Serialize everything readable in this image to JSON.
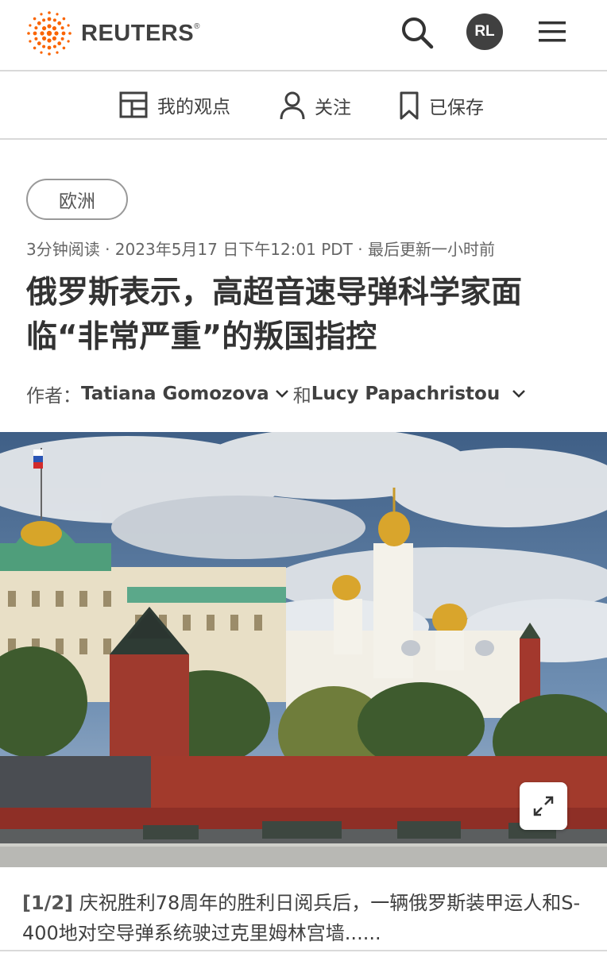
{
  "header": {
    "brand": "REUTERS",
    "brand_mark": "®",
    "avatar_initials": "RL",
    "icons": [
      "reuters-logo-icon",
      "search-icon",
      "hamburger-menu-icon"
    ]
  },
  "subnav": {
    "my_view": "我的观点",
    "following": "关注",
    "saved": "已保存"
  },
  "article": {
    "section": "欧洲",
    "meta": "3分钟阅读 · 2023年5月17 日下午12:01 PDT · 最后更新一小时前",
    "headline": "俄罗斯表示，高超音速导弹科学家面临“非常严重”的叛国指控",
    "byline_prefix": "作者：",
    "author1": "Tatiana Gomozova",
    "conjunction": "和",
    "author2": "Lucy Papachristou"
  },
  "photo": {
    "index": "[1/2]",
    "caption": "庆祝胜利78周年的胜利日阅兵后，一辆俄罗斯装甲运人和S-400地对空导弹系统驶过克里姆林宫墙......"
  },
  "colors": {
    "brand_orange": "#fa6400",
    "text_dark": "#404040",
    "rule": "#d9d9d9"
  }
}
